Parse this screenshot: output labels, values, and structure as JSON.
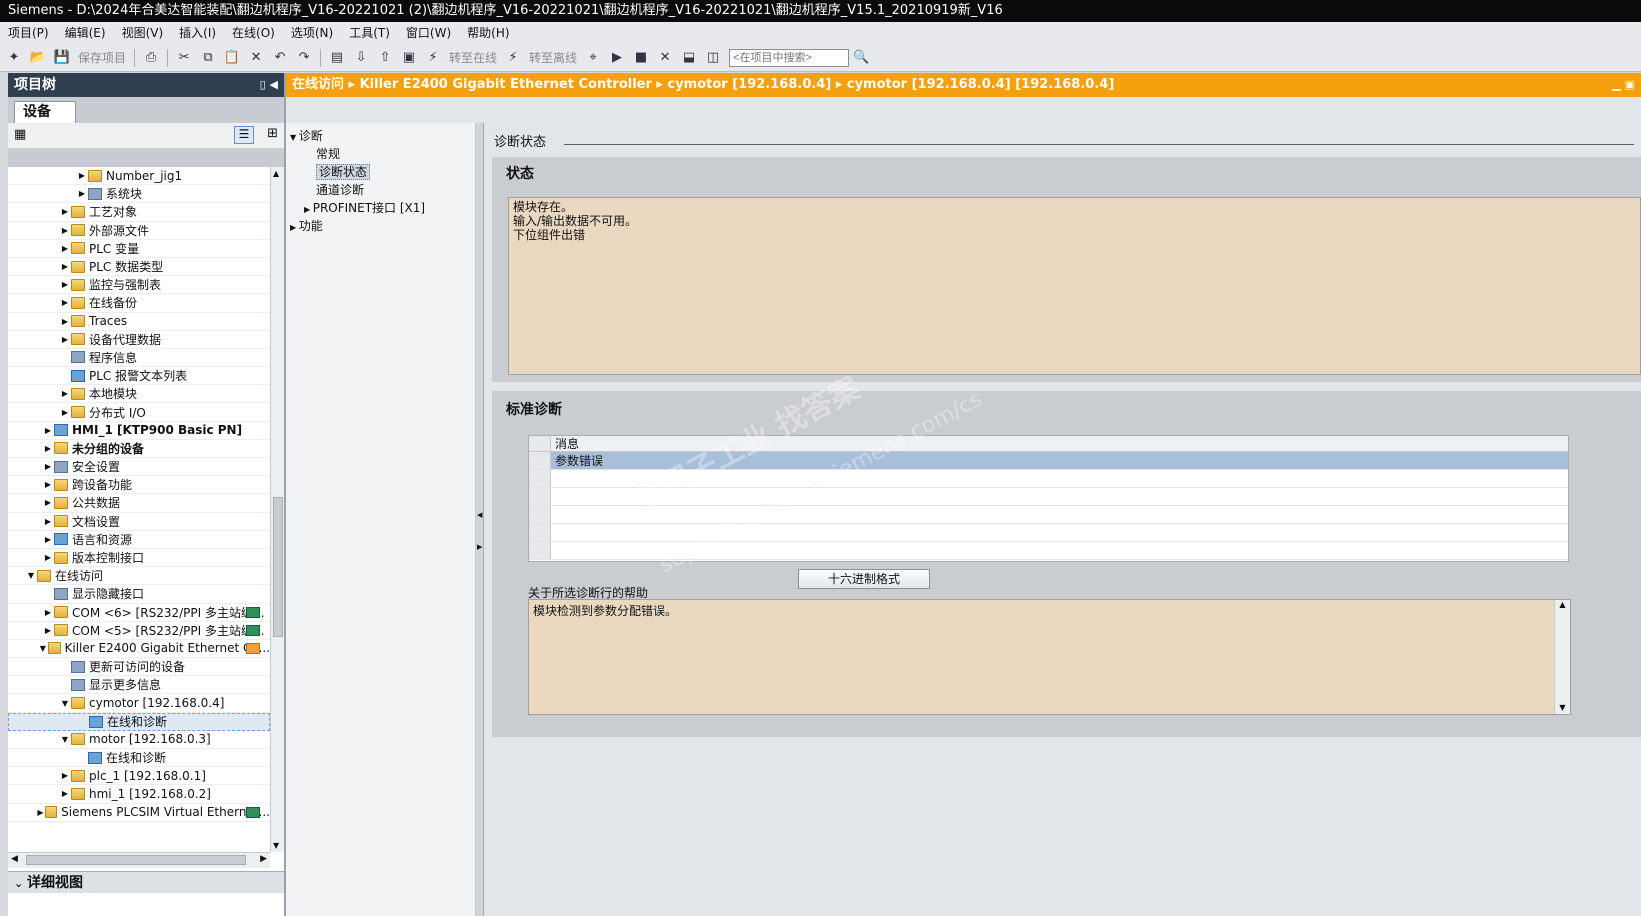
{
  "window": {
    "title": "Siemens  -  D:\\2024年合美达智能装配\\翻边机程序_V16-20221021 (2)\\翻边机程序_V16-20221021\\翻边机程序_V16-20221021\\翻边机程序_V15.1_20210919新_V16"
  },
  "menu": [
    "项目(P)",
    "编辑(E)",
    "视图(V)",
    "插入(I)",
    "在线(O)",
    "选项(N)",
    "工具(T)",
    "窗口(W)",
    "帮助(H)"
  ],
  "toolbar": {
    "save_label": "保存项目",
    "go_online": "转至在线",
    "go_offline": "转至离线",
    "search_placeholder": "<在项目中搜索>"
  },
  "left_panel": {
    "title": "项目树",
    "tab": "设备",
    "detail_view": "详细视图"
  },
  "tree": [
    {
      "label": "Number_jig1",
      "indent": 4,
      "arrow": "▶",
      "icon": "folder"
    },
    {
      "label": "系统块",
      "indent": 4,
      "arrow": "▶",
      "icon": "gear"
    },
    {
      "label": "工艺对象",
      "indent": 3,
      "arrow": "▶",
      "icon": "folder"
    },
    {
      "label": "外部源文件",
      "indent": 3,
      "arrow": "▶",
      "icon": "folder"
    },
    {
      "label": "PLC 变量",
      "indent": 3,
      "arrow": "▶",
      "icon": "folder"
    },
    {
      "label": "PLC 数据类型",
      "indent": 3,
      "arrow": "▶",
      "icon": "folder"
    },
    {
      "label": "监控与强制表",
      "indent": 3,
      "arrow": "▶",
      "icon": "folder"
    },
    {
      "label": "在线备份",
      "indent": 3,
      "arrow": "▶",
      "icon": "folder"
    },
    {
      "label": "Traces",
      "indent": 3,
      "arrow": "▶",
      "icon": "folder"
    },
    {
      "label": "设备代理数据",
      "indent": 3,
      "arrow": "▶",
      "icon": "folder"
    },
    {
      "label": "程序信息",
      "indent": 3,
      "arrow": "",
      "icon": "gear"
    },
    {
      "label": "PLC 报警文本列表",
      "indent": 3,
      "arrow": "",
      "icon": "bluei"
    },
    {
      "label": "本地模块",
      "indent": 3,
      "arrow": "▶",
      "icon": "folder"
    },
    {
      "label": "分布式 I/O",
      "indent": 3,
      "arrow": "▶",
      "icon": "folder"
    },
    {
      "label": "HMI_1 [KTP900 Basic PN]",
      "indent": 2,
      "arrow": "▶",
      "icon": "bluei",
      "bold": true
    },
    {
      "label": "未分组的设备",
      "indent": 2,
      "arrow": "▶",
      "icon": "folder",
      "bold": true
    },
    {
      "label": "安全设置",
      "indent": 2,
      "arrow": "▶",
      "icon": "gear"
    },
    {
      "label": "跨设备功能",
      "indent": 2,
      "arrow": "▶",
      "icon": "folder"
    },
    {
      "label": "公共数据",
      "indent": 2,
      "arrow": "▶",
      "icon": "folder"
    },
    {
      "label": "文档设置",
      "indent": 2,
      "arrow": "▶",
      "icon": "folder"
    },
    {
      "label": "语言和资源",
      "indent": 2,
      "arrow": "▶",
      "icon": "bluei"
    },
    {
      "label": "版本控制接口",
      "indent": 2,
      "arrow": "▶",
      "icon": "folder"
    },
    {
      "label": "在线访问",
      "indent": 1,
      "arrow": "▼",
      "icon": "folder"
    },
    {
      "label": "显示隐藏接口",
      "indent": 2,
      "arrow": "",
      "icon": "gear"
    },
    {
      "label": "COM <6> [RS232/PPI 多主站编...",
      "indent": 2,
      "arrow": "▶",
      "icon": "folder",
      "badge": "green"
    },
    {
      "label": "COM <5> [RS232/PPI 多主站编...",
      "indent": 2,
      "arrow": "▶",
      "icon": "folder",
      "badge": "green"
    },
    {
      "label": "Killer E2400 Gigabit Ethernet Co...",
      "indent": 2,
      "arrow": "▼",
      "icon": "folder",
      "badge": "orange"
    },
    {
      "label": "更新可访问的设备",
      "indent": 3,
      "arrow": "",
      "icon": "gear"
    },
    {
      "label": "显示更多信息",
      "indent": 3,
      "arrow": "",
      "icon": "gear"
    },
    {
      "label": "cymotor [192.168.0.4]",
      "indent": 3,
      "arrow": "▼",
      "icon": "folder"
    },
    {
      "label": "在线和诊断",
      "indent": 4,
      "arrow": "",
      "icon": "bluei",
      "selected": true
    },
    {
      "label": "motor [192.168.0.3]",
      "indent": 3,
      "arrow": "▼",
      "icon": "folder"
    },
    {
      "label": "在线和诊断",
      "indent": 4,
      "arrow": "",
      "icon": "bluei"
    },
    {
      "label": "plc_1 [192.168.0.1]",
      "indent": 3,
      "arrow": "▶",
      "icon": "folder"
    },
    {
      "label": "hmi_1 [192.168.0.2]",
      "indent": 3,
      "arrow": "▶",
      "icon": "folder"
    },
    {
      "label": "Siemens PLCSIM Virtual Ethernet...",
      "indent": 2,
      "arrow": "▶",
      "icon": "folder",
      "badge": "green"
    }
  ],
  "breadcrumb": [
    "在线访问",
    "Killer E2400 Gigabit Ethernet Controller",
    "cymotor [192.168.0.4]",
    "cymotor [192.168.0.4] [192.168.0.4]"
  ],
  "nav": {
    "diag": "诊断",
    "general": "常规",
    "diag_status": "诊断状态",
    "channel_diag": "通道诊断",
    "profinet": "PROFINET接口 [X1]",
    "functions": "功能"
  },
  "content": {
    "section_title": "诊断状态",
    "status_heading": "状态",
    "status_lines": [
      "模块存在。",
      "输入/输出数据不可用。",
      "下位组件出错"
    ],
    "std_heading": "标准诊断",
    "table_header": "消息",
    "table_rows": [
      "参数错误"
    ],
    "hex_button": "十六进制格式",
    "help_label": "关于所选诊断行的帮助",
    "help_text": "模块检测到参数分配错误。"
  },
  "watermark": {
    "line1": "西门子工业 找答案",
    "line2": "support.industry.siemens.com/cs"
  }
}
